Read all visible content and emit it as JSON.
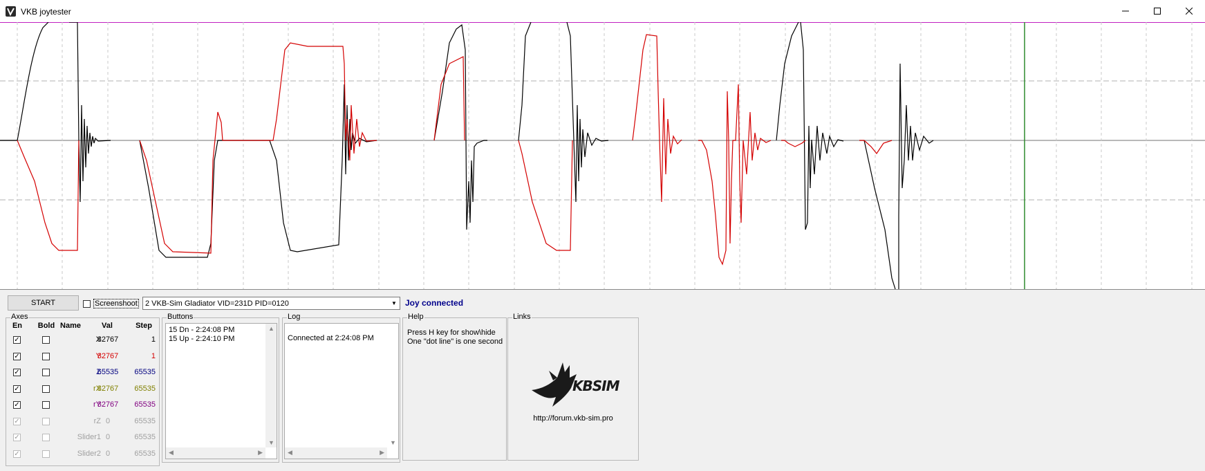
{
  "window": {
    "title": "VKB joytester"
  },
  "controls": {
    "start_label": "START",
    "screenshot_label": "Screenshoot",
    "device_selected": "2  VKB-Sim Gladiator  VID=231D PID=0120",
    "status": "Joy connected"
  },
  "axes": {
    "title": "Axes",
    "headers": {
      "en": "En",
      "bold": "Bold",
      "name": "Name",
      "val": "Val",
      "step": "Step"
    },
    "rows": [
      {
        "name": "X",
        "val": "32767",
        "step": "1",
        "color": "#000000",
        "enabled": true,
        "active": true
      },
      {
        "name": "Y",
        "val": "32767",
        "step": "1",
        "color": "#d40000",
        "enabled": true,
        "active": true
      },
      {
        "name": "Z",
        "val": "65535",
        "step": "65535",
        "color": "#00007f",
        "enabled": true,
        "active": true
      },
      {
        "name": "rX",
        "val": "32767",
        "step": "65535",
        "color": "#808000",
        "enabled": true,
        "active": true
      },
      {
        "name": "rY",
        "val": "32767",
        "step": "65535",
        "color": "#800080",
        "enabled": true,
        "active": true
      },
      {
        "name": "rZ",
        "val": "0",
        "step": "65535",
        "color": "#a0a0a0",
        "enabled": true,
        "active": false
      },
      {
        "name": "Slider1",
        "val": "0",
        "step": "65535",
        "color": "#a0a0a0",
        "enabled": true,
        "active": false
      },
      {
        "name": "Slider2",
        "val": "0",
        "step": "65535",
        "color": "#a0a0a0",
        "enabled": true,
        "active": false
      }
    ]
  },
  "buttons": {
    "title": "Buttons",
    "items": [
      "15 Dn - 2:24:08 PM",
      "15 Up - 2:24:10 PM"
    ]
  },
  "log": {
    "title": "Log",
    "items": [
      "Connected at 2:24:08 PM"
    ]
  },
  "help": {
    "title": "Help",
    "lines": [
      "Press H key for show\\hide",
      "One \"dot line\" is one second"
    ]
  },
  "links": {
    "title": "Links",
    "logo_text": "KBSIM",
    "url": "http://forum.vkb-sim.pro"
  },
  "icons": [
    "vkb-app-icon",
    "minimize-icon",
    "maximize-icon",
    "close-icon",
    "chevron-down-icon",
    "scroll-up-icon",
    "scroll-down-icon",
    "scroll-left-icon",
    "scroll-right-icon",
    "vkb-eagle-logo"
  ]
}
